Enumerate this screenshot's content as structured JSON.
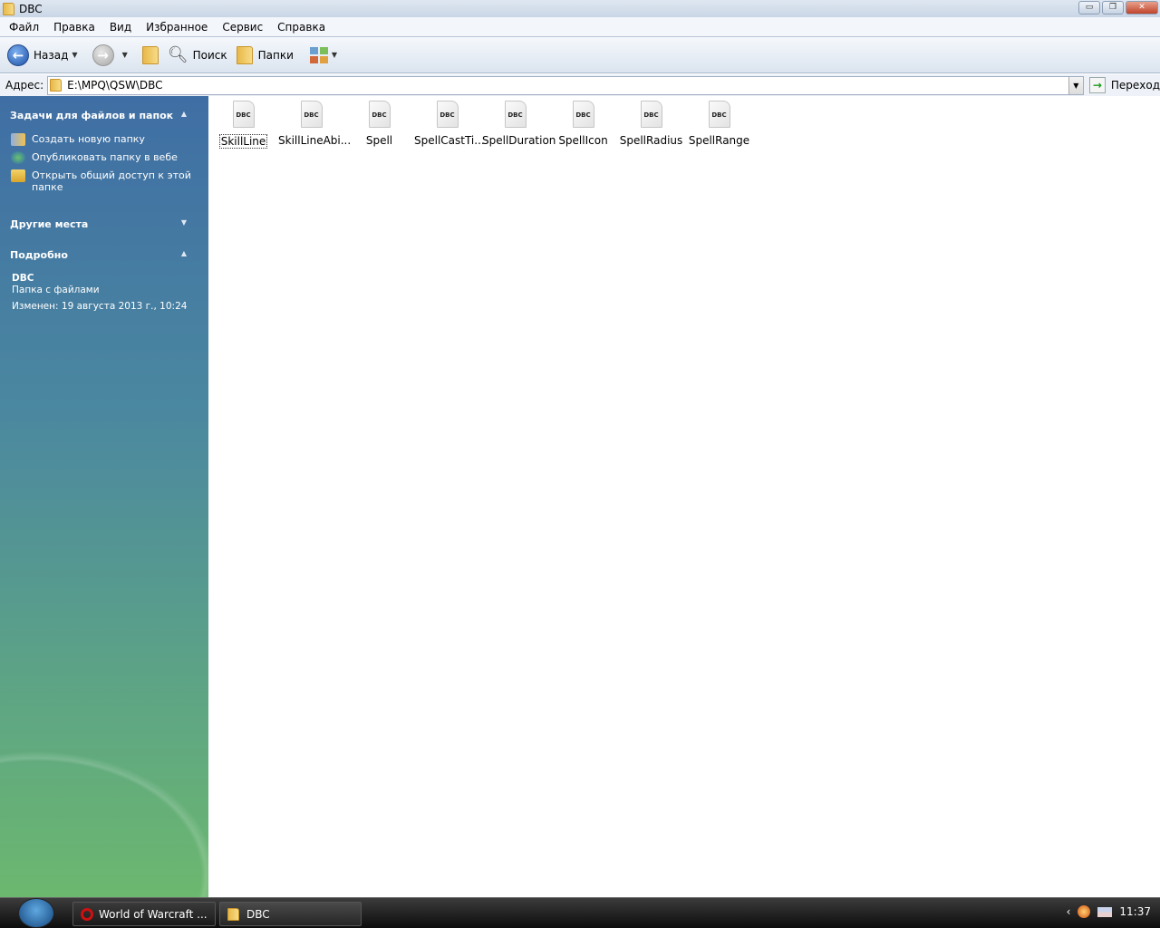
{
  "window": {
    "title": "DBC",
    "min": "▭",
    "restore": "❐",
    "close": "✕"
  },
  "menu": [
    "Файл",
    "Правка",
    "Вид",
    "Избранное",
    "Сервис",
    "Справка"
  ],
  "toolbar": {
    "back": "Назад",
    "search": "Поиск",
    "folders": "Папки"
  },
  "address": {
    "label": "Адрес:",
    "value": "E:\\MPQ\\QSW\\DBC",
    "go": "Переход"
  },
  "sidebar": {
    "tasks_title": "Задачи для файлов и папок",
    "tasks": [
      "Создать новую папку",
      "Опубликовать папку в вебе",
      "Открыть общий доступ к этой папке"
    ],
    "other_title": "Другие места",
    "details_title": "Подробно",
    "details": {
      "name": "DBC",
      "type": "Папка с файлами",
      "modified": "Изменен: 19 августа 2013 г., 10:24"
    }
  },
  "files": [
    {
      "name": "SkillLine",
      "badge": "DBC"
    },
    {
      "name": "SkillLineAbi...",
      "badge": "DBC"
    },
    {
      "name": "Spell",
      "badge": "DBC"
    },
    {
      "name": "SpellCastTi...",
      "badge": "DBC"
    },
    {
      "name": "SpellDuration",
      "badge": "DBC"
    },
    {
      "name": "SpellIcon",
      "badge": "DBC"
    },
    {
      "name": "SpellRadius",
      "badge": "DBC"
    },
    {
      "name": "SpellRange",
      "badge": "DBC"
    }
  ],
  "taskbar": {
    "items": [
      "World of Warcraft ...",
      "DBC"
    ],
    "clock": "11:37"
  }
}
